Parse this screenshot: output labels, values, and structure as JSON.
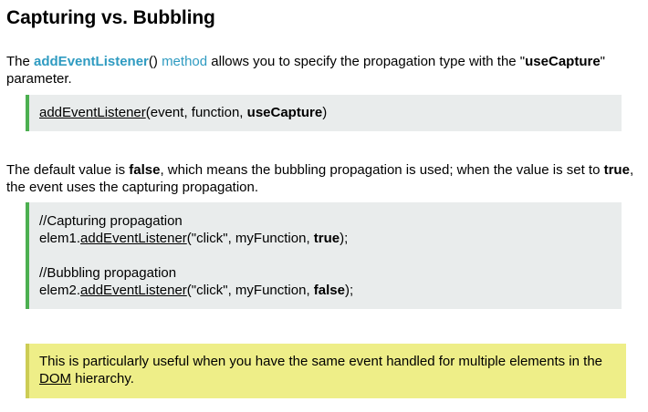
{
  "title": "Capturing vs. Bubbling",
  "intro": {
    "text_before": "The ",
    "link_function": "addEventListener",
    "paren": "()",
    "link_method": "method",
    "text_after": " allows you to specify the propagation type with the \"",
    "param_bold": "useCapture",
    "text_end": "\" parameter."
  },
  "signature": {
    "func": "addEventListener",
    "args_start": "(event, function, ",
    "param": "useCapture",
    "args_end": ")"
  },
  "default_text": {
    "before": "The default value is ",
    "false_word": "false",
    "middle": ", which means the bubbling propagation is used; when the value is set to ",
    "true_word": "true",
    "after": ", the event uses the capturing propagation."
  },
  "example": {
    "comment1": "//Capturing propagation",
    "line1_obj": "elem1.",
    "line1_func": "addEventListener",
    "line1_args": "(\"click\", myFunction, ",
    "line1_val": "true",
    "line1_end": ");",
    "comment2": "//Bubbling propagation",
    "line2_obj": "elem2.",
    "line2_func": "addEventListener",
    "line2_args": "(\"click\", myFunction, ",
    "line2_val": "false",
    "line2_end": ");"
  },
  "note": {
    "before": "This is particularly useful when you have the same event handled for multiple elements in the ",
    "dom": "DOM",
    "after": " hierarchy."
  },
  "colors": {
    "link": "#2f9bc1",
    "code_bg": "#e9ecec",
    "code_border": "#4caf50",
    "note_bg": "#eeee88",
    "note_border": "#cccc55"
  }
}
